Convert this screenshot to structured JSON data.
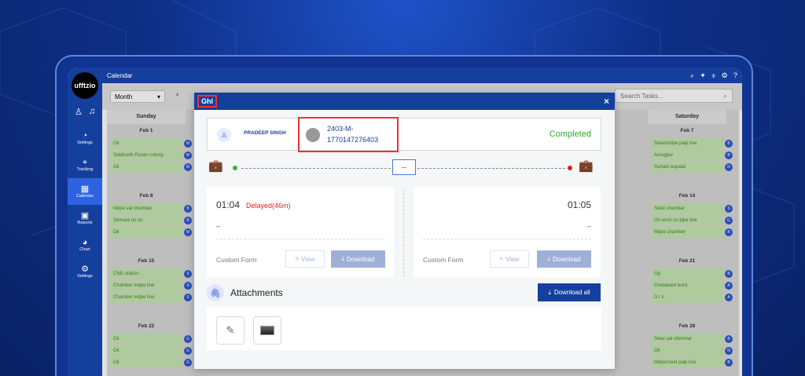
{
  "app": {
    "logo": "ufftzio",
    "page_title": "Calendar",
    "topbar_icons": [
      "search-icon",
      "star-icon",
      "filter-icon",
      "settings-icon",
      "help-icon"
    ]
  },
  "sidebar": {
    "items": [
      {
        "label": "Settings",
        "icon": "speedometer-icon"
      },
      {
        "label": "Tracking",
        "icon": "location-icon"
      },
      {
        "label": "Calendar",
        "icon": "calendar-icon"
      },
      {
        "label": "Reports",
        "icon": "report-icon"
      },
      {
        "label": "Chart",
        "icon": "chart-icon"
      },
      {
        "label": "Settings",
        "icon": "gear-icon"
      }
    ]
  },
  "toolbar": {
    "view": "Month",
    "search_placeholder": "Search Tasks..."
  },
  "calendar": {
    "left": {
      "header": "Sunday",
      "weeks": [
        {
          "date": "Feb 1",
          "events": [
            {
              "name": "Ok",
              "badge": "M"
            },
            {
              "name": "Siddharth Puram colony",
              "badge": "M"
            },
            {
              "name": "Ok",
              "badge": "M"
            }
          ]
        },
        {
          "date": "Feb 8",
          "events": [
            {
              "name": "Mdpe val chembar",
              "badge": "B"
            },
            {
              "name": "Semara do do",
              "badge": "B"
            },
            {
              "name": "Ok",
              "badge": "M"
            }
          ]
        },
        {
          "date": "Feb 15",
          "events": [
            {
              "name": "CNG station",
              "badge": "S"
            },
            {
              "name": "Chamber mdpe line",
              "badge": "S"
            },
            {
              "name": "Chamber mdpe line",
              "badge": "S"
            }
          ]
        },
        {
          "date": "Feb 22",
          "events": [
            {
              "name": "Ok",
              "badge": "G"
            },
            {
              "name": "Ok",
              "badge": "G"
            },
            {
              "name": "Ok",
              "badge": "G"
            }
          ]
        }
      ]
    },
    "right": {
      "header": "Saturday",
      "weeks": [
        {
          "date": "Feb 7",
          "events": [
            {
              "name": "Steel/mdpe paip line",
              "badge": "B"
            },
            {
              "name": "Amugpur",
              "badge": "B"
            },
            {
              "name": "Sarkari aspatal",
              "badge": "N"
            }
          ]
        },
        {
          "date": "Feb 14",
          "events": [
            {
              "name": "Steel chembar",
              "badge": "S"
            },
            {
              "name": "On work on pipe line",
              "badge": "G"
            },
            {
              "name": "Mdpe chamber",
              "badge": "B"
            }
          ]
        },
        {
          "date": "Feb 21",
          "events": [
            {
              "name": "Gg",
              "badge": "B"
            },
            {
              "name": "Chetawani bord",
              "badge": "A"
            },
            {
              "name": "D r s",
              "badge": "A"
            }
          ]
        },
        {
          "date": "Feb 28",
          "events": [
            {
              "name": "Steel val chembar",
              "badge": "B"
            },
            {
              "name": "Ok",
              "badge": "N"
            },
            {
              "name": "Mdpe/steel paip line",
              "badge": "B"
            }
          ]
        }
      ]
    }
  },
  "modal": {
    "title": "Ghl",
    "close": "×",
    "user": {
      "name": "PRADEEP SINGH"
    },
    "task": {
      "id_line1": "2403-M-",
      "id_line2": "1770147276403"
    },
    "status": "Completed",
    "duration": "--",
    "start": {
      "time": "01:04",
      "delay": "Delayed(46m)",
      "value": "--",
      "custom_form": "Custom Form",
      "view_label": "View",
      "download_label": "Download"
    },
    "end": {
      "time": "01:05",
      "value": "--",
      "custom_form": "Custom Form",
      "view_label": "View",
      "download_label": "Download"
    },
    "attachments": {
      "title": "Attachments",
      "download_all": "Download all"
    }
  },
  "colors": {
    "primary": "#153f9d",
    "completed": "#35a52d",
    "delay": "#d22222",
    "start_green": "#34b33b",
    "end_red": "#d91f1f"
  }
}
